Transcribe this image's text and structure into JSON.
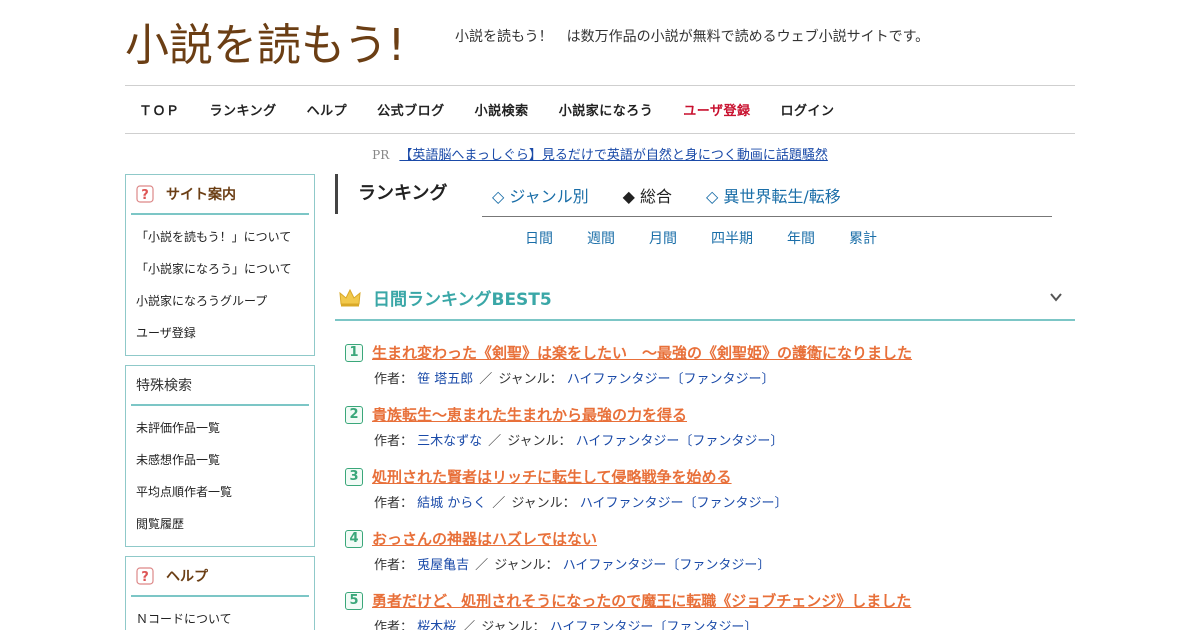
{
  "site": {
    "logo_text": "小説を読もう!",
    "tagline": "小説を読もう！　は数万作品の小説が無料で読めるウェブ小説サイトです。"
  },
  "nav": [
    {
      "label": "ＴＯＰ",
      "red": false
    },
    {
      "label": "ランキング",
      "red": false
    },
    {
      "label": "ヘルプ",
      "red": false
    },
    {
      "label": "公式ブログ",
      "red": false
    },
    {
      "label": "小説検索",
      "red": false
    },
    {
      "label": "小説家になろう",
      "red": false
    },
    {
      "label": "ユーザ登録",
      "red": true
    },
    {
      "label": "ログイン",
      "red": false
    }
  ],
  "pr": {
    "tag": "PR",
    "text": "【英語脳へまっしぐら】見るだけで英語が自然と身につく動画に話題騒然"
  },
  "sidebar": {
    "site_guide": {
      "title": "サイト案内",
      "items": [
        "「小説を読もう！」について",
        "「小説家になろう」について",
        "小説家になろうグループ",
        "ユーザ登録"
      ]
    },
    "special_search": {
      "title": "特殊検索",
      "items": [
        "未評価作品一覧",
        "未感想作品一覧",
        "平均点順作者一覧",
        "閲覧履歴"
      ]
    },
    "help": {
      "title": "ヘルプ",
      "items": [
        "Ｎコードについて"
      ]
    }
  },
  "ranking": {
    "title": "ランキング",
    "tabs": [
      {
        "label": "◇ ジャンル別",
        "active": false
      },
      {
        "label": "◆ 総合",
        "active": true
      },
      {
        "label": "◇ 異世界転生/転移",
        "active": false
      }
    ],
    "periods": [
      "日間",
      "週間",
      "月間",
      "四半期",
      "年間",
      "累計"
    ],
    "section_title": "日間ランキングBEST5",
    "author_label": "作者：",
    "genre_label": "ジャンル：",
    "separator": "／",
    "items": [
      {
        "rank": "1",
        "title": "生まれ変わった《剣聖》は楽をしたい　～最強の《剣聖姫》の護衛になりました",
        "author": "笹 塔五郎",
        "genre": "ハイファンタジー〔ファンタジー〕"
      },
      {
        "rank": "2",
        "title": "貴族転生～恵まれた生まれから最強の力を得る",
        "author": "三木なずな",
        "genre": "ハイファンタジー〔ファンタジー〕"
      },
      {
        "rank": "3",
        "title": "処刑された賢者はリッチに転生して侵略戦争を始める",
        "author": "結城 からく",
        "genre": "ハイファンタジー〔ファンタジー〕"
      },
      {
        "rank": "4",
        "title": "おっさんの神器はハズレではない",
        "author": "兎屋亀吉",
        "genre": "ハイファンタジー〔ファンタジー〕"
      },
      {
        "rank": "5",
        "title": "勇者だけど、処刑されそうになったので魔王に転職《ジョブチェンジ》しました",
        "author": "桜木桜",
        "genre": "ハイファンタジー〔ファンタジー〕"
      }
    ]
  },
  "colors": {
    "accent_teal": "#3aa7a7",
    "title_orange": "#e8703a",
    "link_blue": "#1a4aa8",
    "logo_brown": "#6b3e14",
    "nav_red": "#c8102e"
  }
}
